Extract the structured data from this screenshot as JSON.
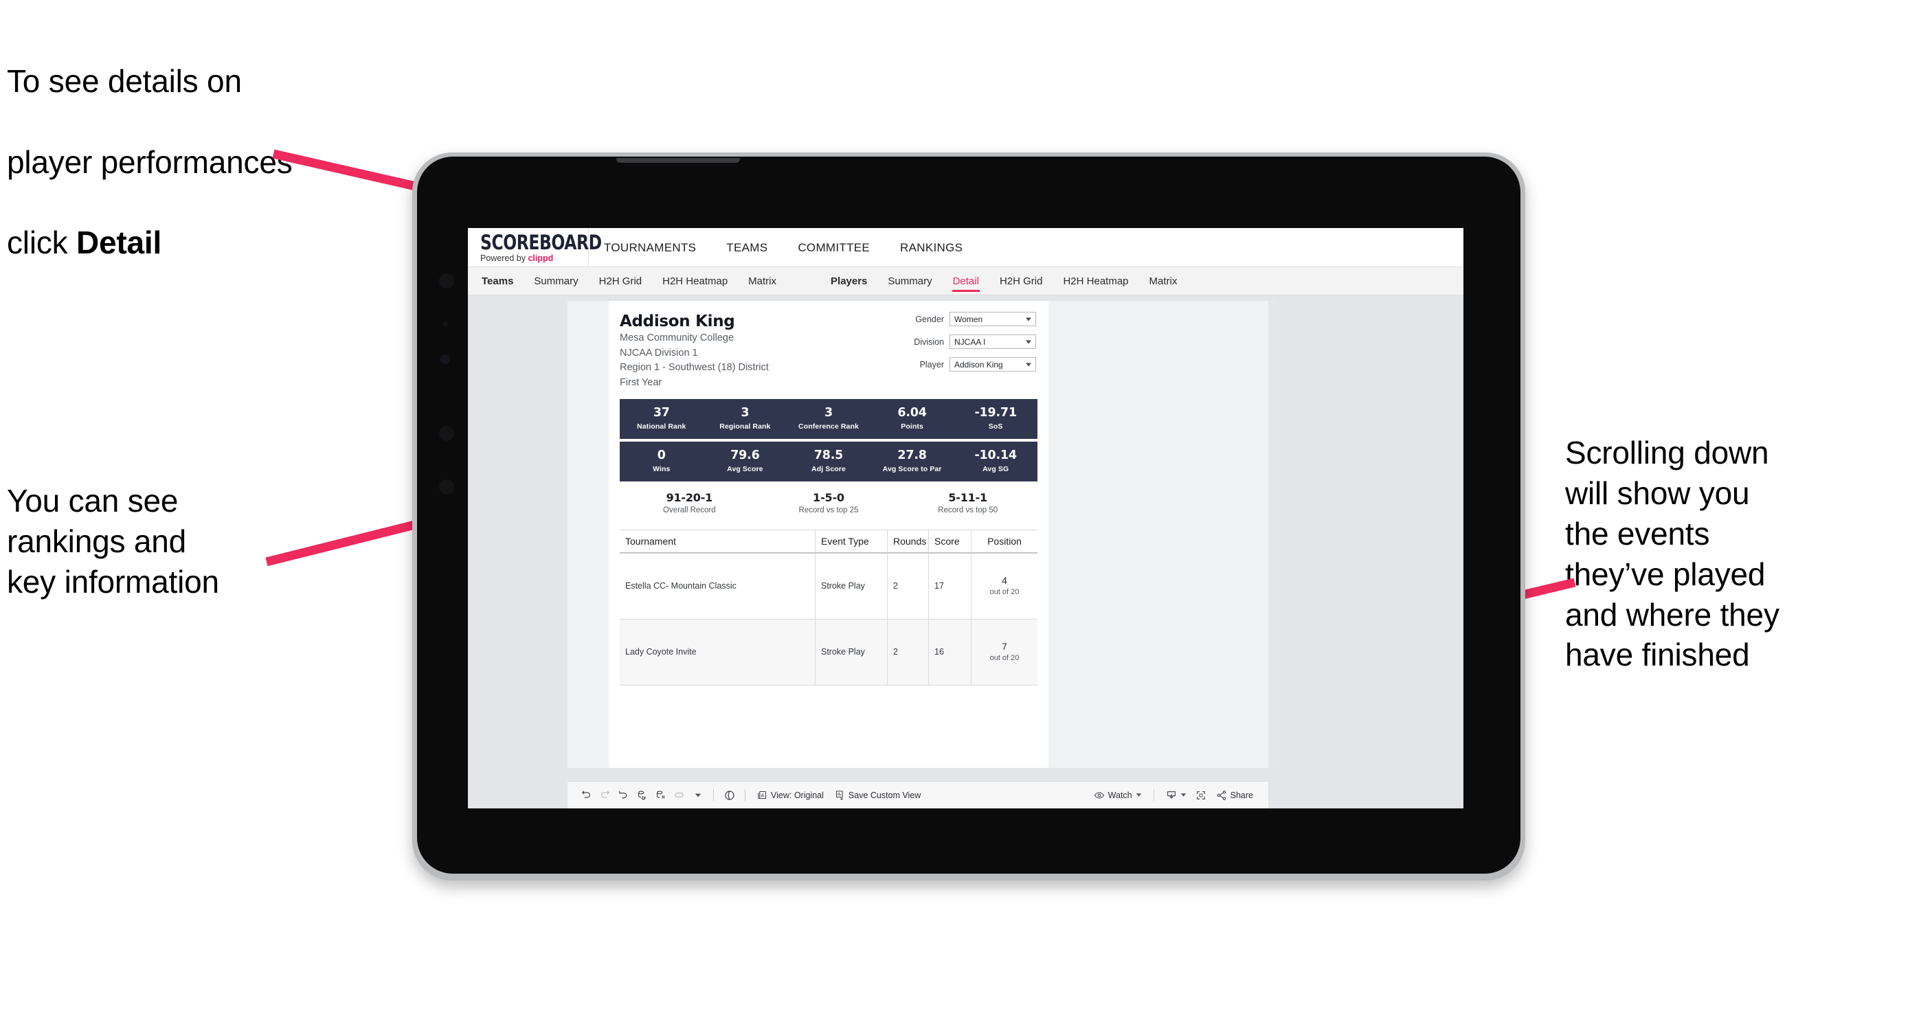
{
  "annotations": {
    "top_left": {
      "line1": "To see details on",
      "line2": "player performances",
      "line3_prefix": "click ",
      "line3_bold": "Detail"
    },
    "left": "You can see\nrankings and\nkey information",
    "right": "Scrolling down\nwill show you\nthe events\nthey’ve played\nand where they\nhave finished"
  },
  "app": {
    "logo": {
      "word": "SCOREBOARD",
      "powered_prefix": "Powered by ",
      "brand": "clippd"
    },
    "top_nav": [
      "TOURNAMENTS",
      "TEAMS",
      "COMMITTEE",
      "RANKINGS"
    ],
    "sub_nav_left": [
      "Teams",
      "Summary",
      "H2H Grid",
      "H2H Heatmap",
      "Matrix"
    ],
    "sub_nav_right": [
      "Players",
      "Summary",
      "Detail",
      "H2H Grid",
      "H2H Heatmap",
      "Matrix"
    ],
    "active_tab": "Detail",
    "accent_color": "#ee2a5f",
    "band_color": "#2f364d"
  },
  "player": {
    "name": "Addison King",
    "school": "Mesa Community College",
    "division": "NJCAA Division 1",
    "region": "Region 1 - Southwest (18) District",
    "year": "First Year"
  },
  "filters": [
    {
      "label": "Gender",
      "value": "Women"
    },
    {
      "label": "Division",
      "value": "NJCAA I"
    },
    {
      "label": "Player",
      "value": "Addison King"
    }
  ],
  "stats_row1": [
    {
      "value": "37",
      "label": "National Rank"
    },
    {
      "value": "3",
      "label": "Regional Rank"
    },
    {
      "value": "3",
      "label": "Conference Rank"
    },
    {
      "value": "6.04",
      "label": "Points"
    },
    {
      "value": "-19.71",
      "label": "SoS"
    }
  ],
  "stats_row2": [
    {
      "value": "0",
      "label": "Wins"
    },
    {
      "value": "79.6",
      "label": "Avg Score"
    },
    {
      "value": "78.5",
      "label": "Adj Score"
    },
    {
      "value": "27.8",
      "label": "Avg Score to Par"
    },
    {
      "value": "-10.14",
      "label": "Avg SG"
    }
  ],
  "records": [
    {
      "value": "91-20-1",
      "label": "Overall Record"
    },
    {
      "value": "1-5-0",
      "label": "Record vs top 25"
    },
    {
      "value": "5-11-1",
      "label": "Record vs top 50"
    }
  ],
  "table": {
    "headers": [
      "Tournament",
      "Event Type",
      "Rounds",
      "Score",
      "Position"
    ],
    "rows": [
      {
        "tournament": "Estella CC- Mountain Classic",
        "event_type": "Stroke Play",
        "rounds": "2",
        "score": "17",
        "position_num": "4",
        "position_of": "out of 20"
      },
      {
        "tournament": "Lady Coyote Invite",
        "event_type": "Stroke Play",
        "rounds": "2",
        "score": "16",
        "position_num": "7",
        "position_of": "out of 20"
      }
    ]
  },
  "toolbar": {
    "view_label": "View: Original",
    "save_label": "Save Custom View",
    "watch_label": "Watch",
    "share_label": "Share"
  }
}
